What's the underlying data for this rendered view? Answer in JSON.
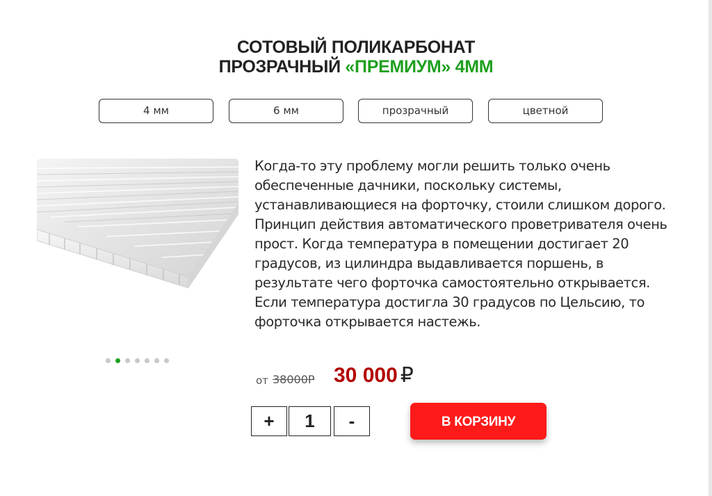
{
  "header": {
    "title_line1": "СОТОВЫЙ ПОЛИКАРБОНАТ",
    "title_line2_part1": "ПРОЗРАЧНЫЙ ",
    "title_line2_accent": "«ПРЕМИУМ» 4ММ"
  },
  "filters": [
    {
      "label": "4 мм"
    },
    {
      "label": "6 мм"
    },
    {
      "label": "прозрачный"
    },
    {
      "label": "цветной"
    }
  ],
  "gallery": {
    "image": "polycarbonate-sheet-image",
    "slides_total": 7,
    "active_slide": 2
  },
  "description": "Когда-то эту проблему могли решить только очень обеспеченные дачники, поскольку системы, устанавливающиеся на форточку, стоили слишком дорого. Принцип действия автоматического проветривателя очень прост. Когда температура в помещении достигает 20 градусов, из цилиндра выдавливается поршень, в результате чего форточка самостоятельно открывается. Если температура достигла 30 градусов по Цельсию, то форточка открывается настежь.",
  "price": {
    "prefix": "от",
    "old": "38000Р",
    "new": "30 000",
    "currency": "₽"
  },
  "quantity": {
    "plus_label": "+",
    "value": "1",
    "minus_label": "-"
  },
  "cart_button": "В КОРЗИНУ",
  "colors": {
    "accent_green": "#1fa01f",
    "price_red": "#b30000",
    "button_red": "#ff1a1a"
  }
}
